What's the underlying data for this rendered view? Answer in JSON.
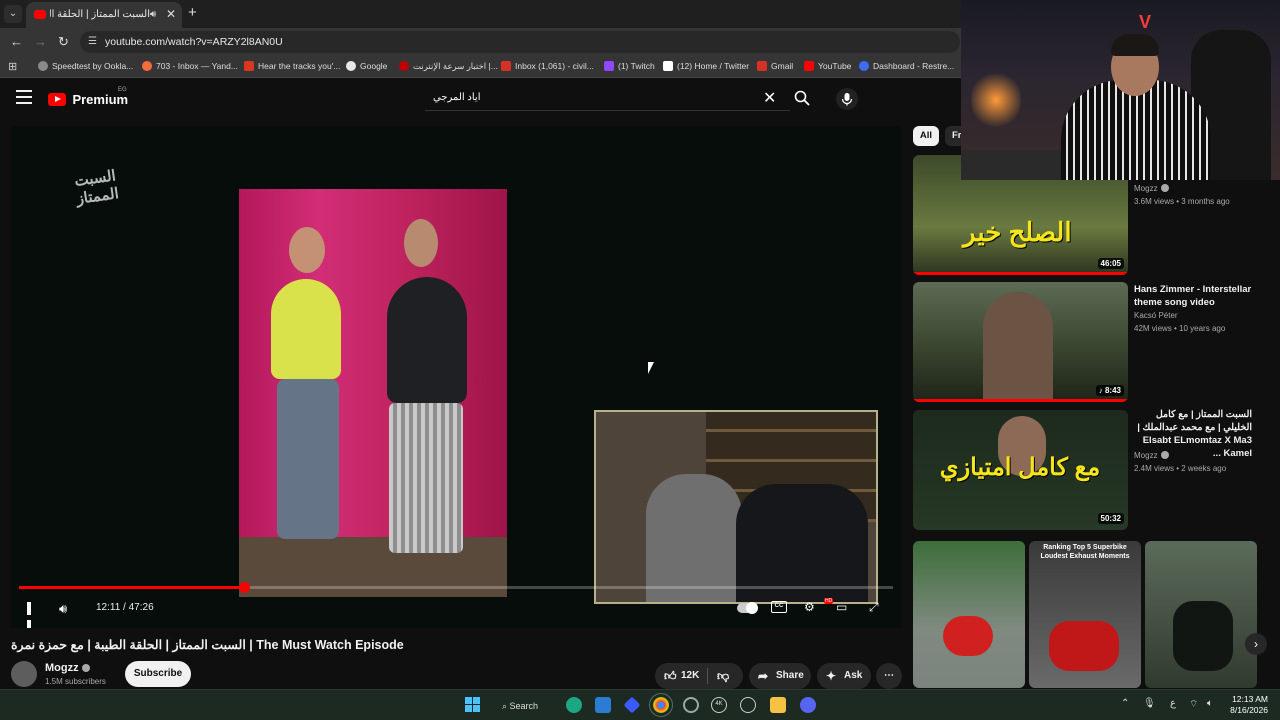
{
  "browser": {
    "tab_title": "السبت الممتاز | الحلقة ال (31)",
    "url": "youtube.com/watch?v=ARZY2l8AN0U",
    "bookmarks": [
      {
        "label": "Speedtest by Ookla...",
        "color": "#8a8a8a"
      },
      {
        "label": "703 - Inbox — Yand...",
        "color": "#ff6b3d"
      },
      {
        "label": "Hear the tracks you'...",
        "color": "#d9381e"
      },
      {
        "label": "Google",
        "color": "#e8e8e8"
      },
      {
        "label": "اختبار سرعة الإنترنت |...",
        "color": "#c00000"
      },
      {
        "label": "Inbox (1,061) - civil...",
        "color": "#d93025"
      },
      {
        "label": "(1) Twitch",
        "color": "#9146ff"
      },
      {
        "label": "(12) Home / Twitter",
        "color": "#ffffff"
      },
      {
        "label": "Gmail",
        "color": "#d93025"
      },
      {
        "label": "YouTube",
        "color": "#ff0000"
      },
      {
        "label": "Dashboard - Restre...",
        "color": "#3d6cff"
      }
    ]
  },
  "header": {
    "logo_text": "Premium",
    "region": "EG",
    "search_value": "اياد المرجي"
  },
  "player": {
    "watermark": "السبت الممتاز",
    "current_time": "12:11",
    "duration": "47:26",
    "time_display": "12:11 / 47:26",
    "progress_fraction": 0.257,
    "hd_badge": "HD",
    "cc_label": "CC"
  },
  "video": {
    "title": "السبت الممتاز | الحلقة الطيبة | مع حمزة نمرة | The Must Watch Episode",
    "channel": "Mogzz",
    "subscribers": "1.5M subscribers",
    "subscribe_label": "Subscribe",
    "likes": "12K",
    "share_label": "Share",
    "ask_label": "Ask"
  },
  "sidebar": {
    "chips": [
      "All",
      "Fr"
    ],
    "recommendations": [
      {
        "title": "",
        "channel": "Mogzz",
        "meta": "3.6M views • 3 months ago",
        "duration": "46:05",
        "thumb_text": "الصلح خير"
      },
      {
        "title": "Hans Zimmer - Interstellar theme song video",
        "channel": "Kacsó Péter",
        "meta": "42M views • 10 years ago",
        "duration": "8:43",
        "thumb_text": ""
      },
      {
        "title": "السبت الممتاز | مع كامل الخليلي | مع محمد عبدالملك | Elsabt ELmomtaz X Ma3 Kamel ...",
        "channel": "Mogzz",
        "meta": "2.4M views • 2 weeks ago",
        "duration": "50:32",
        "thumb_text": "مع كامل امتيازي"
      }
    ],
    "shorts": [
      {
        "caption": ""
      },
      {
        "caption": "Ranking Top 5 Superbike Loudest Exhaust Moments"
      },
      {
        "caption": ""
      }
    ]
  },
  "webcam": {
    "neon_sign": "V"
  },
  "taskbar": {
    "search_label": "Search",
    "time": "12:13 AM",
    "date": "8/16/2026",
    "lang": "ع",
    "badge_4k": "4K"
  },
  "colors": {
    "accent": "#ff0000",
    "background": "#0f0f0f"
  }
}
